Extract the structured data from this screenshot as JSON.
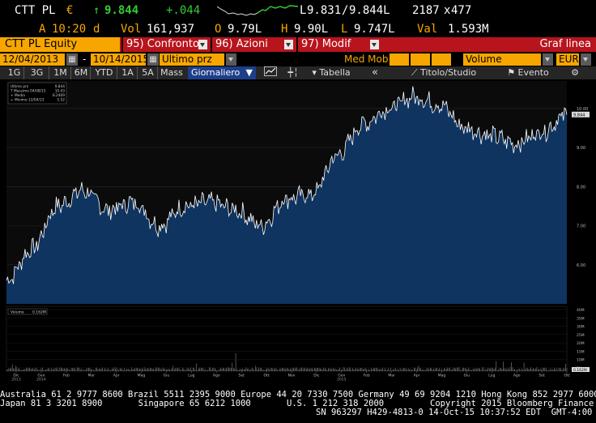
{
  "quote": {
    "ticker": "CTT PL",
    "currency_symbol": "€",
    "trend_arrow": "↑",
    "last_price": "9.844",
    "change": "+.044",
    "ask_flag": "A",
    "time": "10:20",
    "time_flag": "d",
    "vol_label": "Vol",
    "volume": "161,937",
    "open_label": "O",
    "open": "9.79L",
    "high_label": "H",
    "high": "9.90L",
    "low_label": "L",
    "low": "9.747L",
    "val_label": "Val",
    "val": "1.593M",
    "bid_prefix": "L",
    "bid": "9.831",
    "ask_sep": "/",
    "ask": "9.844L",
    "size_bid": "2187",
    "size_sep": "x",
    "size_ask": "477"
  },
  "menu": {
    "security": "CTT PL Equity",
    "items": [
      {
        "num": "95)",
        "label": "Confronto"
      },
      {
        "num": "96)",
        "label": "Azioni"
      },
      {
        "num": "97)",
        "label": "Modif"
      }
    ],
    "right_label": "Graf linea"
  },
  "datebar": {
    "start": "12/04/2013",
    "dash": "-",
    "end": "10/14/2015",
    "price_type": "Ultimo prz",
    "med_mob": "Med Mob",
    "study": "Volume",
    "currency": "EUR"
  },
  "toolbar": {
    "periods": [
      "1G",
      "3G",
      "1M",
      "6M",
      "YTD",
      "1A",
      "5A",
      "Mass"
    ],
    "frequency": "Giornaliero",
    "table": "Tabella",
    "title_study": "Titolo/Studio",
    "event": "Evento"
  },
  "legend": {
    "rows": [
      {
        "label": "Ultimo prz",
        "value": "9.844"
      },
      {
        "label": "T Massimo 04/08/15",
        "value": "10.43"
      },
      {
        "label": "+ Media",
        "value": "8.2409"
      },
      {
        "label": "+ Minimo 12/04/13",
        "value": "5.52"
      }
    ],
    "volume_label": "Volume",
    "volume_value": "0.162M"
  },
  "chart_data": {
    "type": "area",
    "title": "",
    "ylabel": "",
    "ylim": [
      5.0,
      10.7
    ],
    "ytick_labels": [
      "10.00",
      "9.00",
      "8.00",
      "7.00",
      "6.00"
    ],
    "last_value_tag": "9.844",
    "volume_ytick_labels": [
      "40M",
      "35M",
      "30M",
      "25M",
      "20M",
      "15M",
      "10M",
      "5M"
    ],
    "volume_last_tag": "0.162M",
    "x_month_labels": [
      "Dic",
      "Gen",
      "Feb",
      "Mar",
      "Apr",
      "Mag",
      "Giu",
      "Lug",
      "Ago",
      "Set",
      "Ott",
      "Nov",
      "Dic",
      "Gen",
      "Feb",
      "Mar",
      "Apr",
      "Mag",
      "Giu",
      "Lug",
      "Ago",
      "Set",
      "Ott"
    ],
    "x_year_labels": [
      "2013",
      "2014",
      "2015"
    ],
    "series": [
      {
        "x": [
          "2013-12",
          "2014-01",
          "2014-02",
          "2014-03",
          "2014-04",
          "2014-05",
          "2014-06",
          "2014-07",
          "2014-08",
          "2014-09",
          "2014-10",
          "2014-11",
          "2014-12",
          "2015-01",
          "2015-02",
          "2015-03",
          "2015-04",
          "2015-05",
          "2015-06",
          "2015-07",
          "2015-08",
          "2015-09",
          "2015-10"
        ],
        "values": [
          5.6,
          6.4,
          7.5,
          7.9,
          7.4,
          7.6,
          7.0,
          7.5,
          7.6,
          7.4,
          7.0,
          7.7,
          7.8,
          8.8,
          9.6,
          10.0,
          10.3,
          10.1,
          9.5,
          9.3,
          9.1,
          9.4,
          9.84
        ]
      }
    ]
  },
  "footer": {
    "line1": "Australia 61 2 9777 8600 Brazil 5511 2395 9000 Europe 44 20 7330 7500 Germany 49 69 9204 1210 Hong Kong 852 2977 6000",
    "line2": "Japan 81 3 3201 8900       Singapore 65 6212 1000       U.S. 1 212 318 2000         Copyright 2015 Bloomberg Finance L.P.",
    "line3": "SN 963297 H429-4813-0 14-Oct-15 10:37:52 EDT  GMT-4:00"
  },
  "colors": {
    "amber": "#f7a600",
    "red_bar": "#b8141d",
    "area_fill": "#0f3460",
    "line": "#ffffff",
    "green": "#33cc33"
  }
}
